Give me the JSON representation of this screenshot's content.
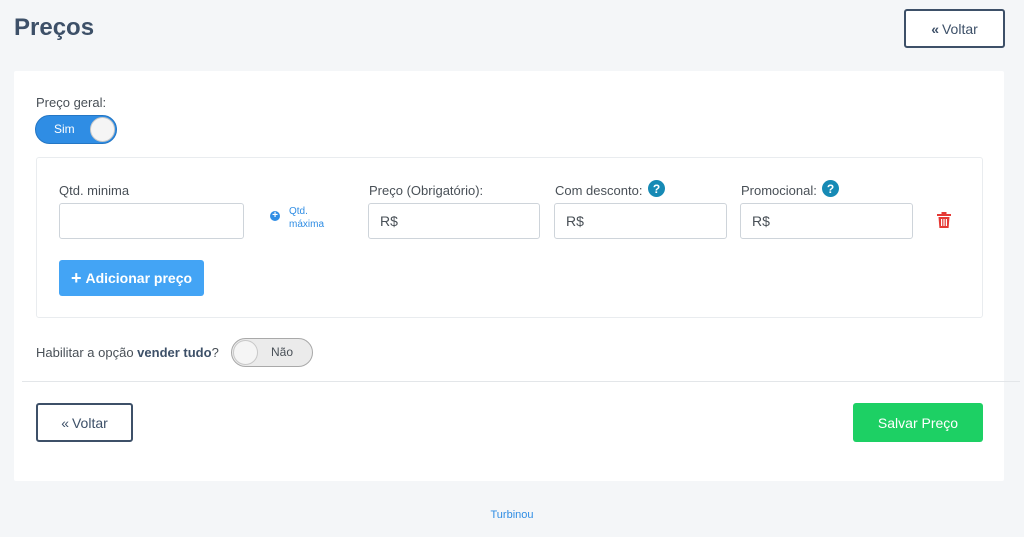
{
  "header": {
    "title": "Preços",
    "back_label": "Voltar",
    "back_icon": "chevrons-left-icon"
  },
  "general_price": {
    "label": "Preço geral:",
    "toggle_label": "Sim",
    "enabled": true
  },
  "price_row": {
    "min_qty_label": "Qtd. minima",
    "min_qty_value": "",
    "add_max_qty_line1": "Qtd.",
    "add_max_qty_line2": "máxima",
    "price_label": "Preço (Obrigatório):",
    "price_value": "R$",
    "discount_label": "Com desconto:",
    "discount_value": "R$",
    "promo_label": "Promocional:",
    "promo_value": "R$",
    "help_icon": "question-circle-icon",
    "delete_icon": "trash-icon"
  },
  "add_price_button": "Adicionar preço",
  "sell_all": {
    "label_prefix": "Habilitar a opção ",
    "label_bold": "vender tudo",
    "label_suffix": "?",
    "toggle_label": "Não",
    "enabled": false
  },
  "actions": {
    "back_label": "Voltar",
    "save_label": "Salvar Preço"
  },
  "footer": {
    "text": "Turbinou"
  },
  "colors": {
    "title": "#3d5068",
    "primary": "#2f8de4",
    "add_button": "#43a4f5",
    "save_button": "#1dd064",
    "danger": "#e53935",
    "help": "#168ab5"
  }
}
